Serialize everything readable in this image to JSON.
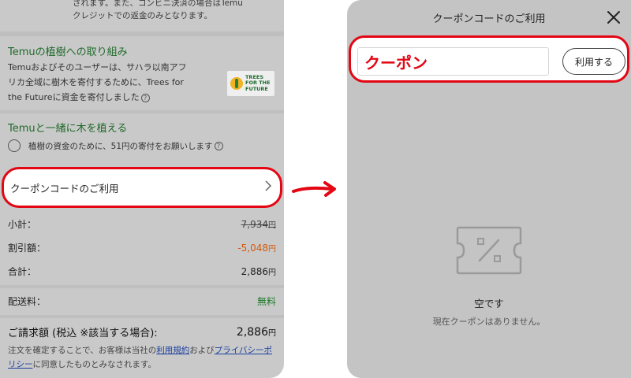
{
  "left": {
    "top_note": {
      "line1": "されます。また、コンビニ決済の場合はTemu",
      "line2": "クレジットでの返金のみとなります。"
    },
    "tree": {
      "title": "Temuの植樹への取り組み",
      "desc_line1": "Temuおよびそのユーザーは、サハラ以南アフ",
      "desc_line2": "リカ全域に樹木を寄付するために、Trees for",
      "desc_line3": "the Futureに資金を寄付しました",
      "logo_text_1": "TREES",
      "logo_text_2": "FOR THE",
      "logo_text_3": "FUTURE"
    },
    "plant": {
      "title": "Temuと一緒に木を植える",
      "text": "植樹の資金のために、51円の寄付をお願いします"
    },
    "coupon_row_label": "クーポンコードのご利用",
    "summary": {
      "subtotal_label": "小計：",
      "subtotal_value": "7,934",
      "discount_label": "割引額：",
      "discount_value": "-5,048",
      "total_label": "合計：",
      "total_value": "2,886",
      "shipping_label": "配送料：",
      "shipping_value": "無料",
      "billing_label": "ご請求額 (税込 ※該当する場合):",
      "billing_value": "2,886",
      "yen": "円"
    },
    "legal": {
      "part1": "注文を確定することで、お客様は当社の",
      "terms_link": "利用規約",
      "part2": "および",
      "privacy_link": "プライバシーポリシー",
      "part3": "に同意したものとみなされます。"
    }
  },
  "right": {
    "title": "クーポンコードのご利用",
    "input_value": "クーポン",
    "apply_label": "利用する",
    "empty_title": "空です",
    "empty_sub": "現在クーポンはありません。"
  },
  "colors": {
    "highlight_red": "#e30613",
    "green_title": "#1f6a2a",
    "discount_orange": "#d4590c",
    "link_blue": "#1a3fa0"
  },
  "icons": {
    "chevron": "chevron-right-icon",
    "close": "close-icon",
    "help": "question-circle-icon",
    "empty": "coupon-ticket-icon",
    "arrow": "curved-arrow-right-icon"
  }
}
